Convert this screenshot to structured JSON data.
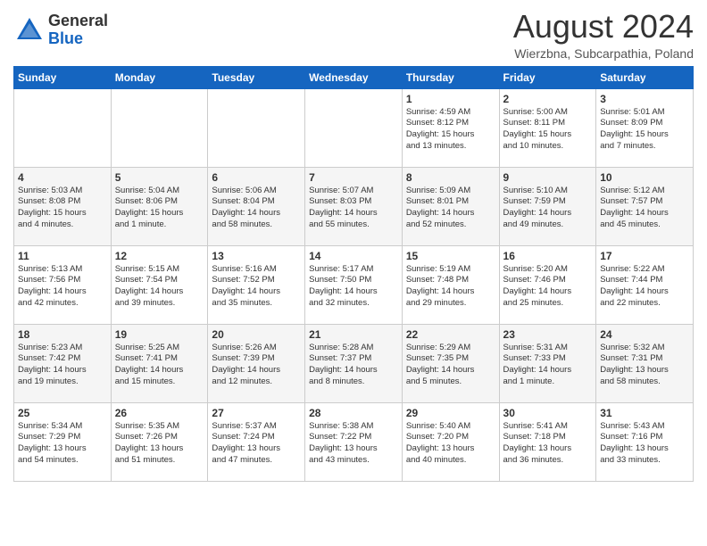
{
  "header": {
    "logo_general": "General",
    "logo_blue": "Blue",
    "main_title": "August 2024",
    "subtitle": "Wierzbna, Subcarpathia, Poland"
  },
  "days_of_week": [
    "Sunday",
    "Monday",
    "Tuesday",
    "Wednesday",
    "Thursday",
    "Friday",
    "Saturday"
  ],
  "weeks": [
    [
      {
        "day": "",
        "info": ""
      },
      {
        "day": "",
        "info": ""
      },
      {
        "day": "",
        "info": ""
      },
      {
        "day": "",
        "info": ""
      },
      {
        "day": "1",
        "info": "Sunrise: 4:59 AM\nSunset: 8:12 PM\nDaylight: 15 hours\nand 13 minutes."
      },
      {
        "day": "2",
        "info": "Sunrise: 5:00 AM\nSunset: 8:11 PM\nDaylight: 15 hours\nand 10 minutes."
      },
      {
        "day": "3",
        "info": "Sunrise: 5:01 AM\nSunset: 8:09 PM\nDaylight: 15 hours\nand 7 minutes."
      }
    ],
    [
      {
        "day": "4",
        "info": "Sunrise: 5:03 AM\nSunset: 8:08 PM\nDaylight: 15 hours\nand 4 minutes."
      },
      {
        "day": "5",
        "info": "Sunrise: 5:04 AM\nSunset: 8:06 PM\nDaylight: 15 hours\nand 1 minute."
      },
      {
        "day": "6",
        "info": "Sunrise: 5:06 AM\nSunset: 8:04 PM\nDaylight: 14 hours\nand 58 minutes."
      },
      {
        "day": "7",
        "info": "Sunrise: 5:07 AM\nSunset: 8:03 PM\nDaylight: 14 hours\nand 55 minutes."
      },
      {
        "day": "8",
        "info": "Sunrise: 5:09 AM\nSunset: 8:01 PM\nDaylight: 14 hours\nand 52 minutes."
      },
      {
        "day": "9",
        "info": "Sunrise: 5:10 AM\nSunset: 7:59 PM\nDaylight: 14 hours\nand 49 minutes."
      },
      {
        "day": "10",
        "info": "Sunrise: 5:12 AM\nSunset: 7:57 PM\nDaylight: 14 hours\nand 45 minutes."
      }
    ],
    [
      {
        "day": "11",
        "info": "Sunrise: 5:13 AM\nSunset: 7:56 PM\nDaylight: 14 hours\nand 42 minutes."
      },
      {
        "day": "12",
        "info": "Sunrise: 5:15 AM\nSunset: 7:54 PM\nDaylight: 14 hours\nand 39 minutes."
      },
      {
        "day": "13",
        "info": "Sunrise: 5:16 AM\nSunset: 7:52 PM\nDaylight: 14 hours\nand 35 minutes."
      },
      {
        "day": "14",
        "info": "Sunrise: 5:17 AM\nSunset: 7:50 PM\nDaylight: 14 hours\nand 32 minutes."
      },
      {
        "day": "15",
        "info": "Sunrise: 5:19 AM\nSunset: 7:48 PM\nDaylight: 14 hours\nand 29 minutes."
      },
      {
        "day": "16",
        "info": "Sunrise: 5:20 AM\nSunset: 7:46 PM\nDaylight: 14 hours\nand 25 minutes."
      },
      {
        "day": "17",
        "info": "Sunrise: 5:22 AM\nSunset: 7:44 PM\nDaylight: 14 hours\nand 22 minutes."
      }
    ],
    [
      {
        "day": "18",
        "info": "Sunrise: 5:23 AM\nSunset: 7:42 PM\nDaylight: 14 hours\nand 19 minutes."
      },
      {
        "day": "19",
        "info": "Sunrise: 5:25 AM\nSunset: 7:41 PM\nDaylight: 14 hours\nand 15 minutes."
      },
      {
        "day": "20",
        "info": "Sunrise: 5:26 AM\nSunset: 7:39 PM\nDaylight: 14 hours\nand 12 minutes."
      },
      {
        "day": "21",
        "info": "Sunrise: 5:28 AM\nSunset: 7:37 PM\nDaylight: 14 hours\nand 8 minutes."
      },
      {
        "day": "22",
        "info": "Sunrise: 5:29 AM\nSunset: 7:35 PM\nDaylight: 14 hours\nand 5 minutes."
      },
      {
        "day": "23",
        "info": "Sunrise: 5:31 AM\nSunset: 7:33 PM\nDaylight: 14 hours\nand 1 minute."
      },
      {
        "day": "24",
        "info": "Sunrise: 5:32 AM\nSunset: 7:31 PM\nDaylight: 13 hours\nand 58 minutes."
      }
    ],
    [
      {
        "day": "25",
        "info": "Sunrise: 5:34 AM\nSunset: 7:29 PM\nDaylight: 13 hours\nand 54 minutes."
      },
      {
        "day": "26",
        "info": "Sunrise: 5:35 AM\nSunset: 7:26 PM\nDaylight: 13 hours\nand 51 minutes."
      },
      {
        "day": "27",
        "info": "Sunrise: 5:37 AM\nSunset: 7:24 PM\nDaylight: 13 hours\nand 47 minutes."
      },
      {
        "day": "28",
        "info": "Sunrise: 5:38 AM\nSunset: 7:22 PM\nDaylight: 13 hours\nand 43 minutes."
      },
      {
        "day": "29",
        "info": "Sunrise: 5:40 AM\nSunset: 7:20 PM\nDaylight: 13 hours\nand 40 minutes."
      },
      {
        "day": "30",
        "info": "Sunrise: 5:41 AM\nSunset: 7:18 PM\nDaylight: 13 hours\nand 36 minutes."
      },
      {
        "day": "31",
        "info": "Sunrise: 5:43 AM\nSunset: 7:16 PM\nDaylight: 13 hours\nand 33 minutes."
      }
    ]
  ]
}
